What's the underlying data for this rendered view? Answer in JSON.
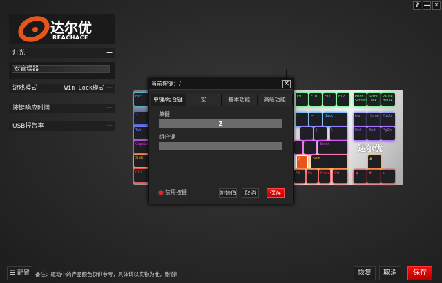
{
  "window": {
    "help": "?",
    "minimize": "—",
    "close": "✕"
  },
  "logo": {
    "brand_cn": "达尔优",
    "brand_en": "REACHACE",
    "accent": "#e8541a"
  },
  "sidebar": [
    {
      "label": "灯光",
      "toggle": "—"
    },
    {
      "label": "宏管理器"
    },
    {
      "label": "游戏模式",
      "value": "Win Lock模式",
      "toggle": "—"
    },
    {
      "label": "按键响应时间",
      "toggle": "—"
    },
    {
      "label": "USB报告率",
      "toggle": "—"
    }
  ],
  "keyboard": {
    "logo_text": "达尔优",
    "keys": [
      "Esc",
      "~",
      "Tab",
      "CapsLock",
      "Shift",
      "Ctrl",
      "F9",
      "F10",
      "F11",
      "F12",
      "Print Screen",
      "Scroll Lock",
      "Pause Break",
      "-",
      "=",
      "Back",
      "Ins",
      "Home",
      "PgUp",
      "[",
      "]",
      "\\",
      "Del",
      "End",
      "PgDn",
      ";",
      "'",
      "Enter",
      "/",
      "Shift",
      "▲",
      "Alt",
      "Fn",
      "Menu",
      "Ctrl",
      "◀",
      "▼",
      "▶"
    ]
  },
  "dialog": {
    "title": "当前按键：/",
    "close": "✕",
    "tabs": [
      "单键/组合键",
      "宏",
      "基本功能",
      "高级功能"
    ],
    "single_key_label": "单键",
    "single_key_value": "Z",
    "combo_key_label": "组合键",
    "combo_key_value": "",
    "disable_label": "禁用按键",
    "reset": "初始值",
    "cancel": "取消",
    "save": "保存"
  },
  "footer": {
    "config": "配置",
    "note": "备注：驱动中的产品颜色仅供参考，具体请以实物为准，谢谢!",
    "restore": "恢复",
    "cancel": "取消",
    "save": "保存"
  }
}
